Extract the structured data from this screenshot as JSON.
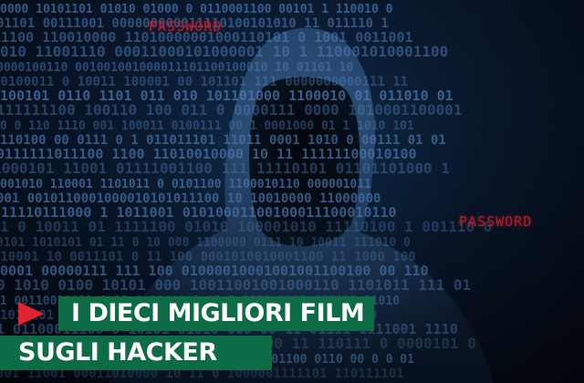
{
  "background": {
    "kind": "photo-illustration",
    "subject": "hooded-figure",
    "matrix_color": "#5b8fd0",
    "overlay_words": [
      "PASSWORD",
      "PASSWORD"
    ],
    "overlay_color": "#b0202c"
  },
  "headline": {
    "line1": "I DIECI MIGLIORI FILM",
    "line2": "SUGLI HACKER",
    "bar_color": "#0d6b46",
    "text_color": "#ffffff"
  },
  "play_icon": {
    "icon": "play-triangle-icon",
    "color": "#e3232f"
  }
}
